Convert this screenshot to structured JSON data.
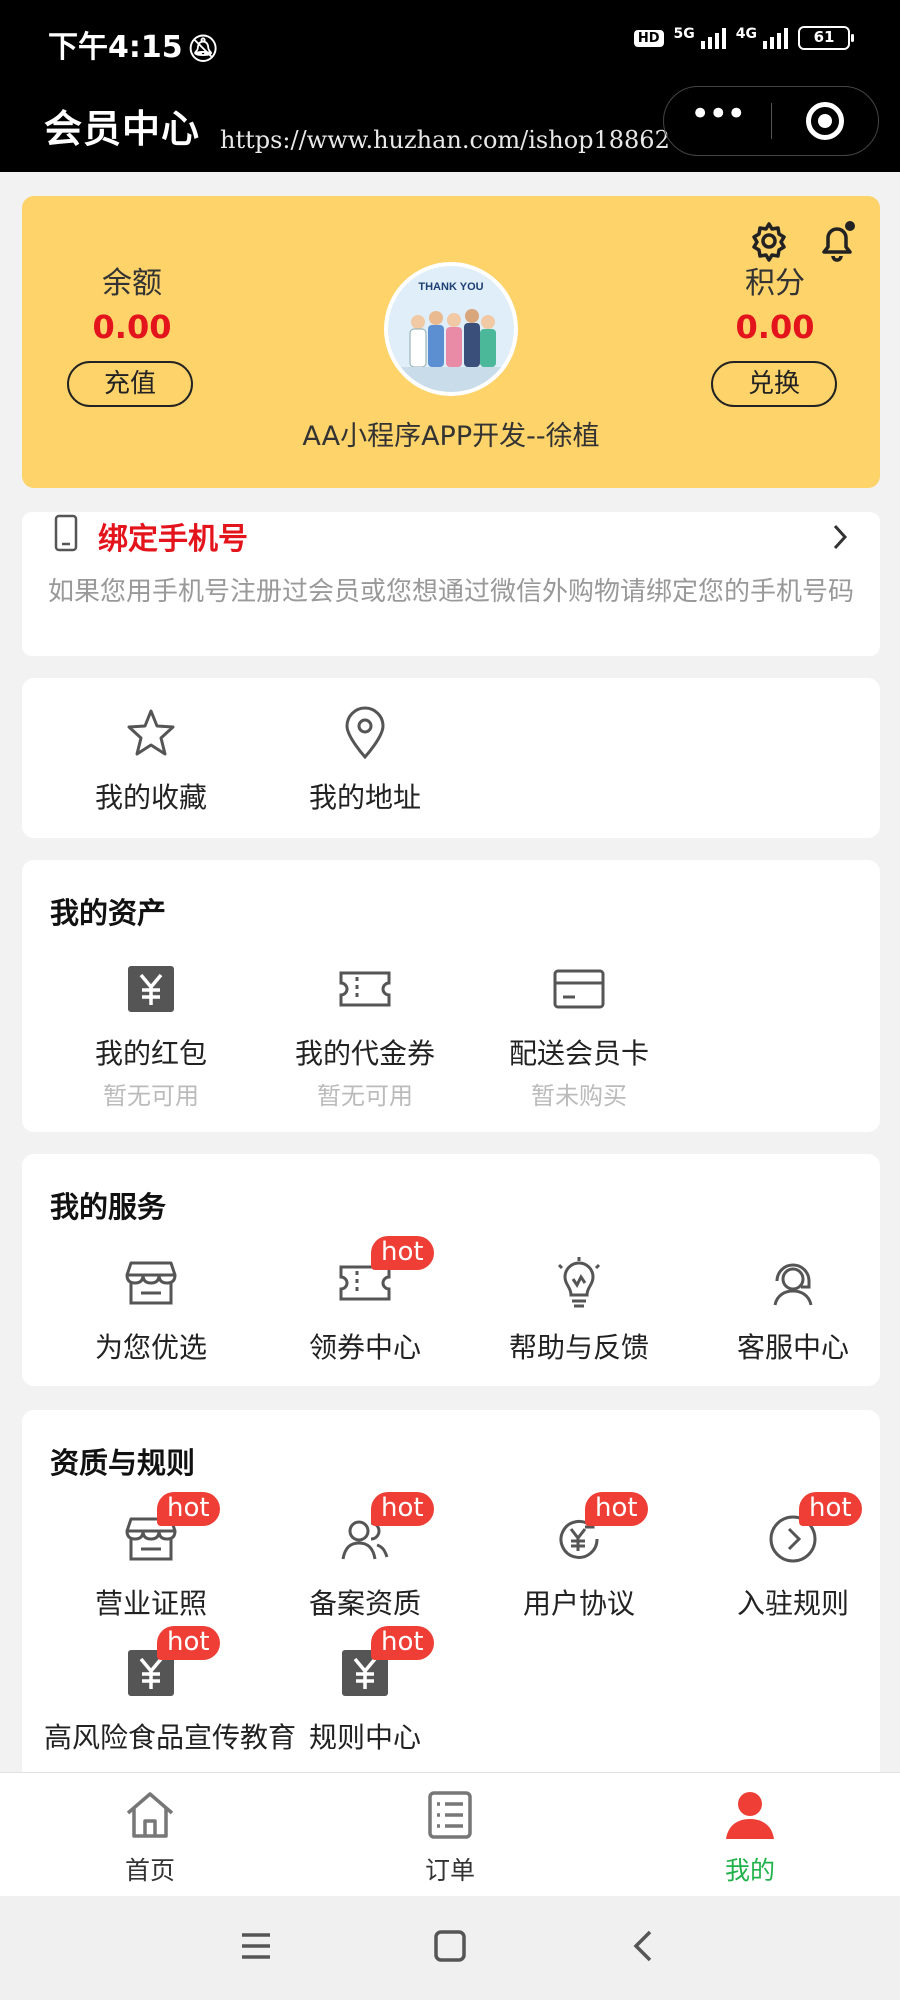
{
  "status_bar": {
    "time": "下午4:15",
    "hd": "HD",
    "net1": "5G",
    "net2": "4G",
    "battery": "61"
  },
  "header": {
    "title": "会员中心",
    "watermark": "https://www.huzhan.com/ishop18862",
    "more_label": "•••"
  },
  "member": {
    "balance_label": "余额",
    "balance_value": "0.00",
    "recharge_button": "充值",
    "points_label": "积分",
    "points_value": "0.00",
    "exchange_button": "兑换",
    "avatar_text": "THANK YOU",
    "nickname": "AA小程序APP开发--徐植"
  },
  "bind_phone": {
    "title": "绑定手机号",
    "description": "如果您用手机号注册过会员或您想通过微信外购物请绑定您的手机号码"
  },
  "quick_links": [
    {
      "label": "我的收藏",
      "icon": "star-icon"
    },
    {
      "label": "我的地址",
      "icon": "location-pin-icon"
    }
  ],
  "assets": {
    "title": "我的资产",
    "items": [
      {
        "label": "我的红包",
        "sub": "暂无可用",
        "icon": "red-packet-icon"
      },
      {
        "label": "我的代金券",
        "sub": "暂无可用",
        "icon": "coupon-icon"
      },
      {
        "label": "配送会员卡",
        "sub": "暂未购买",
        "icon": "card-icon"
      }
    ]
  },
  "services": {
    "title": "我的服务",
    "hot_label": "hot",
    "items": [
      {
        "label": "为您优选",
        "icon": "shop-icon",
        "hot": false
      },
      {
        "label": "领券中心",
        "icon": "ticket-icon",
        "hot": true
      },
      {
        "label": "帮助与反馈",
        "icon": "lightbulb-icon",
        "hot": false
      },
      {
        "label": "客服中心",
        "icon": "headset-icon",
        "hot": false
      }
    ]
  },
  "rules": {
    "title": "资质与规则",
    "hot_label": "hot",
    "items": [
      {
        "label": "营业证照",
        "icon": "shop-icon",
        "hot": true
      },
      {
        "label": "备案资质",
        "icon": "users-icon",
        "hot": true
      },
      {
        "label": "用户协议",
        "icon": "yuan-refresh-icon",
        "hot": true
      },
      {
        "label": "入驻规则",
        "icon": "arrow-circle-icon",
        "hot": true
      },
      {
        "label": "高风险食品宣传教育",
        "icon": "yuan-box-icon",
        "hot": true
      },
      {
        "label": "规则中心",
        "icon": "yuan-box-icon",
        "hot": true
      }
    ]
  },
  "tabbar": {
    "items": [
      {
        "label": "首页",
        "icon": "home-icon"
      },
      {
        "label": "订单",
        "icon": "order-list-icon"
      },
      {
        "label": "我的",
        "icon": "user-icon",
        "active": true
      }
    ],
    "active_color": "#22b24c"
  },
  "colors": {
    "accent_red": "#e4141c",
    "card_yellow": "#fdd36a",
    "hot_badge": "#ee3e36"
  }
}
